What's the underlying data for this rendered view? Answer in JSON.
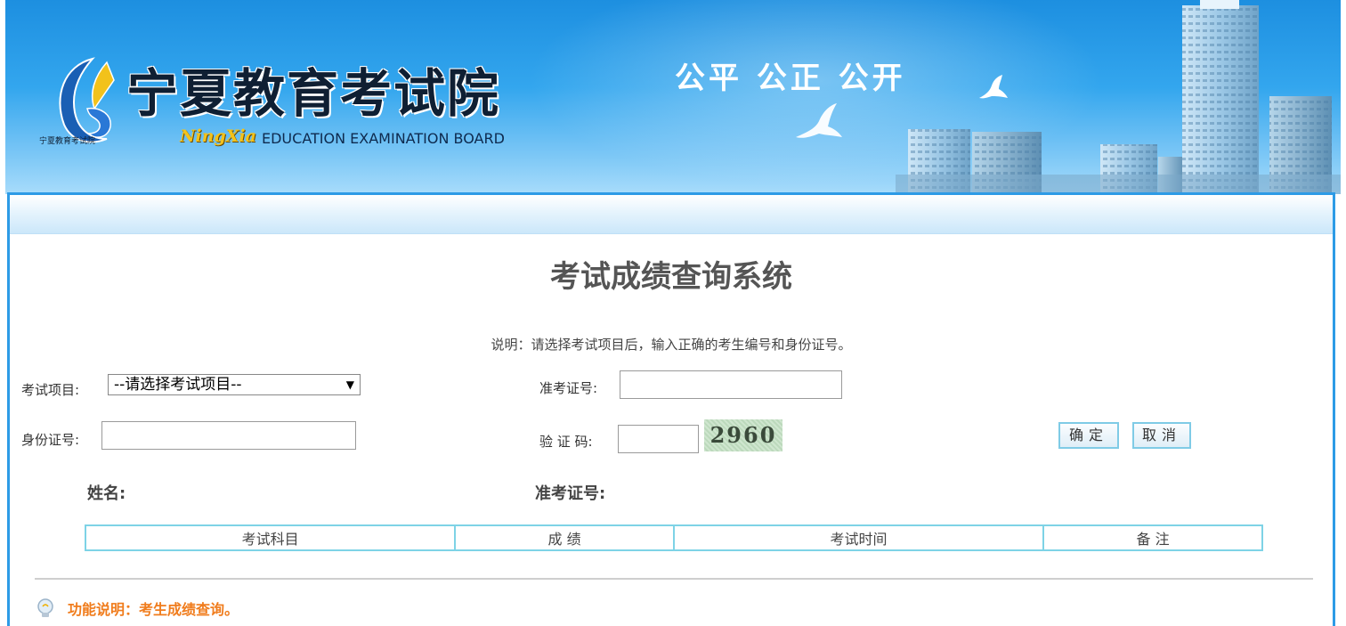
{
  "banner": {
    "logo_cn": "宁夏教育考试院",
    "logo_small": "宁夏教育考试院",
    "logo_ningxia": "NingXia",
    "logo_en": "EDUCATION EXAMINATION BOARD",
    "slogan": "公平 公正 公开"
  },
  "page": {
    "title": "考试成绩查询系统",
    "note": "说明：请选择考试项目后，输入正确的考生编号和身份证号。"
  },
  "form": {
    "exam_item_label": "考试项目:",
    "exam_item_selected": "--请选择考试项目--",
    "ticket_label": "准考证号:",
    "ticket_value": "",
    "id_label": "身份证号:",
    "id_value": "",
    "captcha_label": "验 证 码:",
    "captcha_value": "",
    "captcha_image_text": "2960",
    "confirm_label": "确定",
    "cancel_label": "取消"
  },
  "result": {
    "name_label": "姓名:",
    "ticket_label": "准考证号:",
    "columns": [
      "考试科目",
      "成 绩",
      "考试时间",
      "备 注"
    ]
  },
  "footer": {
    "function_note": "功能说明：考生成绩查询。"
  },
  "colors": {
    "banner_blue": "#1d8fe0",
    "panel_border": "#2d9be6",
    "table_border": "#7ed3e6",
    "accent_orange": "#f07c1c"
  },
  "icons": [
    "logo-emblem-icon",
    "dove-icon",
    "lightbulb-icon",
    "dropdown-arrow-icon"
  ]
}
